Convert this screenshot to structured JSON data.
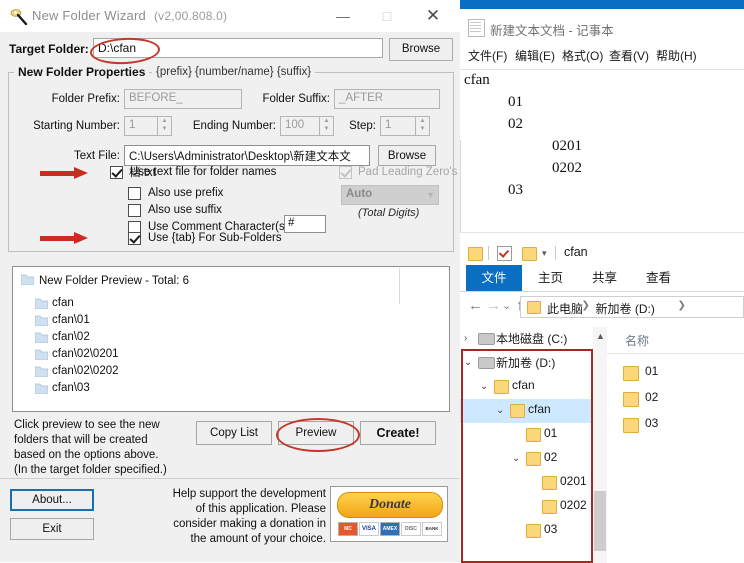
{
  "wizard": {
    "title": "New Folder Wizard",
    "version": "(v2,00.808.0)",
    "icon": "magic-wand-icon",
    "window_buttons": {
      "minimize": "—",
      "maximize": "□",
      "close": "✕"
    },
    "target": {
      "label": "Target Folder:",
      "value": "D:\\cfan",
      "placeholder": "D:\\cfan",
      "browse_label": "Browse"
    },
    "properties": {
      "legend": "New Folder Properties",
      "pattern_hint": "{prefix} {number/name} {suffix}",
      "folder_prefix": {
        "label": "Folder Prefix:",
        "value": "BEFORE_",
        "enabled": false
      },
      "folder_suffix": {
        "label": "Folder Suffix:",
        "value": "_AFTER",
        "enabled": false
      },
      "starting_number": {
        "label": "Starting Number:",
        "value": "1",
        "enabled": false
      },
      "ending_number": {
        "label": "Ending Number:",
        "value": "100",
        "enabled": false
      },
      "step": {
        "label": "Step:",
        "value": "1",
        "enabled": false
      },
      "text_file": {
        "label": "Text File:",
        "value": "C:\\Users\\Administrator\\Desktop\\新建文本文档.txt",
        "browse_label": "Browse"
      },
      "checkboxes": {
        "use_text_file": {
          "label": "Use text file for folder names",
          "checked": true,
          "enabled": true
        },
        "also_prefix": {
          "label": "Also use prefix",
          "checked": false,
          "enabled": true
        },
        "also_suffix": {
          "label": "Also use suffix",
          "checked": false,
          "enabled": true
        },
        "comment_chars": {
          "label": "Use Comment Character(s):",
          "checked": false,
          "enabled": true,
          "value": "#"
        },
        "tab_subfolders": {
          "label": "Use {tab} For Sub-Folders",
          "checked": true,
          "enabled": true
        },
        "pad_zeros": {
          "label": "Pad Leading Zero's",
          "checked": true,
          "enabled": false
        }
      },
      "digits_combo": {
        "value": "Auto",
        "caption": "(Total Digits)"
      }
    },
    "preview": {
      "header": "New Folder Preview - Total: 6",
      "rows": [
        "cfan",
        "cfan\\01",
        "cfan\\02",
        "cfan\\02\\0201",
        "cfan\\02\\0202",
        "cfan\\03"
      ]
    },
    "hint_lines": [
      "Click preview to see the new",
      "folders that will be created",
      "based on the options above.",
      "(In the target folder specified.)"
    ],
    "buttons": {
      "copy_list": "Copy List",
      "preview": "Preview",
      "create": "Create!",
      "about": "About...",
      "exit": "Exit"
    },
    "donate": {
      "text_lines": [
        "Help support the development",
        "of this application. Please",
        "consider making a donation in",
        "the amount of your choice."
      ],
      "button_label": "Donate",
      "cards": [
        "MC",
        "VISA",
        "AMEX",
        "DISC",
        "BANK"
      ]
    },
    "annotations": {
      "highlight_color": "#c0392b",
      "arrow_color": "#cc2b21"
    }
  },
  "notepad": {
    "title": "新建文本文档 - 记事本",
    "icon": "notepad-icon",
    "menu": [
      "文件(F)",
      "编辑(E)",
      "格式(O)",
      "查看(V)",
      "帮助(H)"
    ],
    "content_lines": [
      {
        "text": "cfan",
        "indent": 0
      },
      {
        "text": "01",
        "indent": 1
      },
      {
        "text": "02",
        "indent": 1
      },
      {
        "text": "0201",
        "indent": 2
      },
      {
        "text": "0202",
        "indent": 2
      },
      {
        "text": "03",
        "indent": 1
      }
    ]
  },
  "explorer": {
    "quick_access_title": "cfan",
    "ribbon_tabs": [
      "文件",
      "主页",
      "共享",
      "查看"
    ],
    "active_ribbon_tab": "文件",
    "nav": {
      "back": "←",
      "forward": "→",
      "recent": "⌄",
      "up": "↑"
    },
    "breadcrumbs": [
      "此电脑",
      "新加卷 (D:)"
    ],
    "tree": [
      {
        "label": "本地磁盘 (C:)",
        "depth": 1,
        "twisty": "›",
        "icon": "drive-icon",
        "selected": false
      },
      {
        "label": "新加卷 (D:)",
        "depth": 1,
        "twisty": "⌄",
        "icon": "drive-icon",
        "selected": false
      },
      {
        "label": "cfan",
        "depth": 2,
        "twisty": "⌄",
        "icon": "folder-icon",
        "selected": false
      },
      {
        "label": "cfan",
        "depth": 3,
        "twisty": "⌄",
        "icon": "folder-icon",
        "selected": true
      },
      {
        "label": "01",
        "depth": 4,
        "twisty": "",
        "icon": "folder-icon",
        "selected": false
      },
      {
        "label": "02",
        "depth": 4,
        "twisty": "⌄",
        "icon": "folder-icon",
        "selected": false
      },
      {
        "label": "0201",
        "depth": 5,
        "twisty": "",
        "icon": "folder-icon",
        "selected": false
      },
      {
        "label": "0202",
        "depth": 5,
        "twisty": "",
        "icon": "folder-icon",
        "selected": false
      },
      {
        "label": "03",
        "depth": 4,
        "twisty": "",
        "icon": "folder-icon",
        "selected": false
      }
    ],
    "list_column_header": "名称",
    "list_items": [
      "01",
      "02",
      "03"
    ],
    "highlight_color": "#a32a21"
  }
}
